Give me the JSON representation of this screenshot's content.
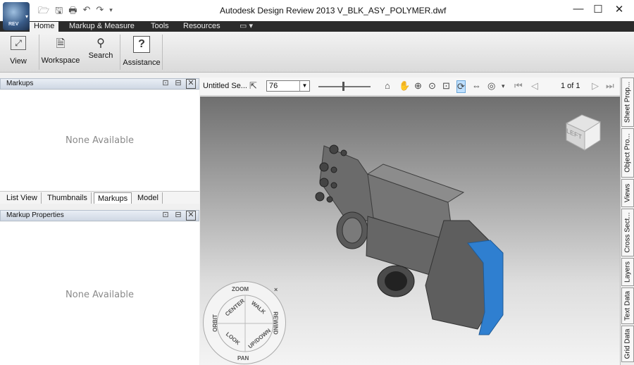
{
  "window": {
    "title": "Autodesk Design Review 2013    V_BLK_ASY_POLYMER.dwf",
    "app_badge": "REV",
    "minimize": "—",
    "maximize": "☐",
    "close": "✕"
  },
  "quick_access": {
    "icons": [
      "open-icon",
      "save-icon",
      "print-icon",
      "undo-icon",
      "redo-icon",
      "qat-dropdown-icon"
    ]
  },
  "ribbon": {
    "tabs": [
      "Home",
      "Markup & Measure",
      "Tools",
      "Resources"
    ],
    "active_tab": "Home",
    "buttons": {
      "view": "View",
      "workspace": "Workspace",
      "search": "Search",
      "assistance": "Assistance"
    }
  },
  "markups_panel": {
    "title": "Markups",
    "empty": "None Available"
  },
  "panel_tabs": [
    "List View",
    "Thumbnails",
    "Markups",
    "Model"
  ],
  "active_panel_tab": "Markups",
  "markup_properties_panel": {
    "title": "Markup Properties",
    "empty": "None Available"
  },
  "viewport_toolbar": {
    "sheet_name": "Untitled Se...",
    "zoom_value": "76",
    "page_indicator": "1 of 1"
  },
  "viewcube": {
    "face_label": "LEFT"
  },
  "steering_wheel": {
    "labels": {
      "zoom": "ZOOM",
      "orbit": "ORBIT",
      "center": "CENTER",
      "walk": "WALK",
      "rewind": "REWIND",
      "look": "LOOK",
      "updown": "UP/DOWN",
      "pan": "PAN"
    }
  },
  "right_tabs": [
    "Sheet Prop...",
    "Object Pro...",
    "Views",
    "Cross Sect...",
    "Layers",
    "Text Data",
    "Grid Data"
  ],
  "colors": {
    "accent_blue": "#2f7fd0",
    "tab_bar": "#2b2b2b",
    "part_gray": "#5c5c5c"
  }
}
